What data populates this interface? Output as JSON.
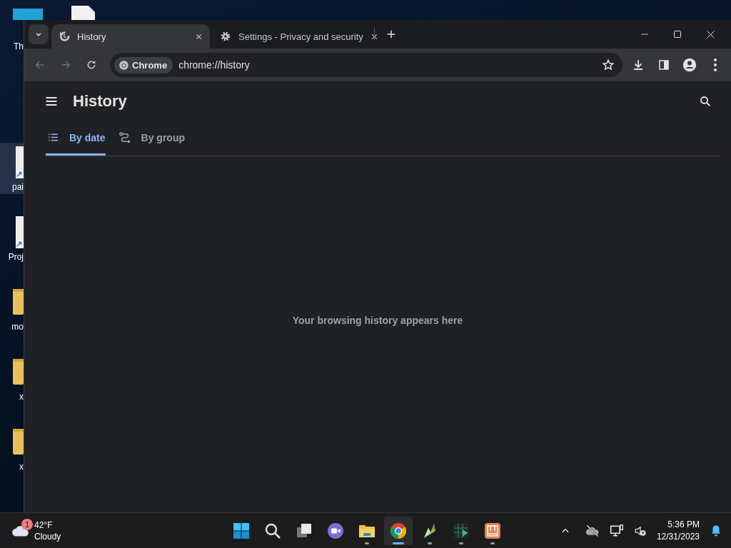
{
  "desktop_icons": [
    {
      "kind": "monitor",
      "label": "Th",
      "selected": false
    },
    {
      "kind": "file",
      "selected": false
    },
    {
      "kind": "shortcut",
      "label": "pai",
      "selected": true
    },
    {
      "kind": "shortcut",
      "label": "Proj",
      "selected": false
    },
    {
      "kind": "folder",
      "label": "mo",
      "selected": false
    },
    {
      "kind": "folder",
      "label": "x",
      "selected": false
    },
    {
      "kind": "folder",
      "label": "x",
      "selected": false
    }
  ],
  "browser": {
    "tabs": [
      {
        "title": "History",
        "selected": true
      },
      {
        "title": "Settings - Privacy and security",
        "selected": false
      }
    ],
    "toolbar": {
      "chip": "Chrome",
      "url": "chrome://history",
      "back_disabled": true,
      "forward_disabled": true
    }
  },
  "page": {
    "title": "History",
    "tabs": [
      {
        "label": "By date",
        "selected": true
      },
      {
        "label": "By group",
        "selected": false
      }
    ],
    "empty_message": "Your browsing history appears here"
  },
  "taskbar": {
    "weather": {
      "temperature": "42°F",
      "condition": "Cloudy",
      "badge": "1"
    },
    "apps": [
      {
        "kind": "start",
        "running": false,
        "selected": false
      },
      {
        "kind": "search",
        "running": false,
        "selected": false
      },
      {
        "kind": "task-view",
        "running": false,
        "selected": false
      },
      {
        "kind": "meet",
        "running": false,
        "selected": false
      },
      {
        "kind": "explorer",
        "running": true,
        "selected": false
      },
      {
        "kind": "chrome",
        "running": true,
        "selected": true
      },
      {
        "kind": "green-app",
        "running": true,
        "selected": false
      },
      {
        "kind": "chart-app",
        "running": true,
        "selected": false
      },
      {
        "kind": "orange-app",
        "running": true,
        "selected": false
      }
    ],
    "time": "5:36 PM",
    "date": "12/31/2023"
  }
}
